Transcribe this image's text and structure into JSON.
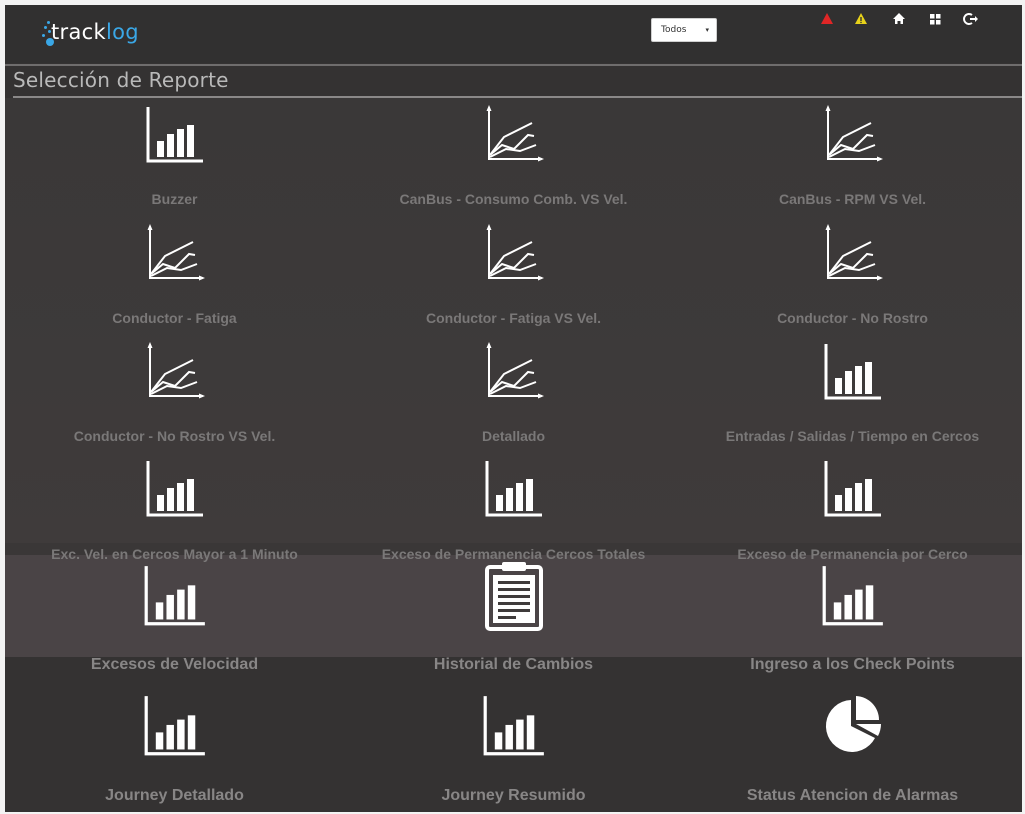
{
  "app": {
    "logo_text_prefix": "track",
    "logo_text_suffix": "log",
    "filter": {
      "selected": "Todos",
      "arrow": "▾"
    },
    "toolbar_icons": [
      "alert-red-icon",
      "alert-yellow-icon",
      "home-icon",
      "grid-icon",
      "logout-icon"
    ]
  },
  "page": {
    "title": "Selección de Reporte"
  },
  "colors": {
    "header": "#313030",
    "background": "#343232",
    "label": "#7a7878",
    "accent": "#3aa7e6",
    "alert_red": "#e02626",
    "alert_yellow": "#e8d21a"
  },
  "reports": [
    {
      "label": "Buzzer",
      "icon": "bar-chart-icon"
    },
    {
      "label": "CanBus - Consumo Comb. VS Vel.",
      "icon": "line-chart-icon"
    },
    {
      "label": "CanBus - RPM VS Vel.",
      "icon": "line-chart-icon"
    },
    {
      "label": "Conductor - Fatiga",
      "icon": "line-chart-icon"
    },
    {
      "label": "Conductor - Fatiga VS Vel.",
      "icon": "line-chart-icon"
    },
    {
      "label": "Conductor - No Rostro",
      "icon": "line-chart-icon"
    },
    {
      "label": "Conductor - No Rostro VS Vel.",
      "icon": "line-chart-icon"
    },
    {
      "label": "Detallado",
      "icon": "line-chart-icon"
    },
    {
      "label": "Entradas / Salidas / Tiempo en Cercos",
      "icon": "bar-chart-icon"
    },
    {
      "label": "Exc. Vel. en Cercos Mayor a 1 Minuto",
      "icon": "bar-chart-icon"
    },
    {
      "label": "Exceso de Permanencia Cercos Totales",
      "icon": "bar-chart-icon"
    },
    {
      "label": "Exceso de Permanencia por Cerco",
      "icon": "bar-chart-icon"
    },
    {
      "label": "Excesos de Velocidad",
      "icon": "bar-chart-icon"
    },
    {
      "label": "Historial de Cambios",
      "icon": "clipboard-icon"
    },
    {
      "label": "Ingreso a los Check Points",
      "icon": "bar-chart-icon"
    },
    {
      "label": "Journey Detallado",
      "icon": "bar-chart-icon"
    },
    {
      "label": "Journey Resumido",
      "icon": "bar-chart-icon"
    },
    {
      "label": "Status Atencion de Alarmas",
      "icon": "pie-chart-icon"
    }
  ]
}
